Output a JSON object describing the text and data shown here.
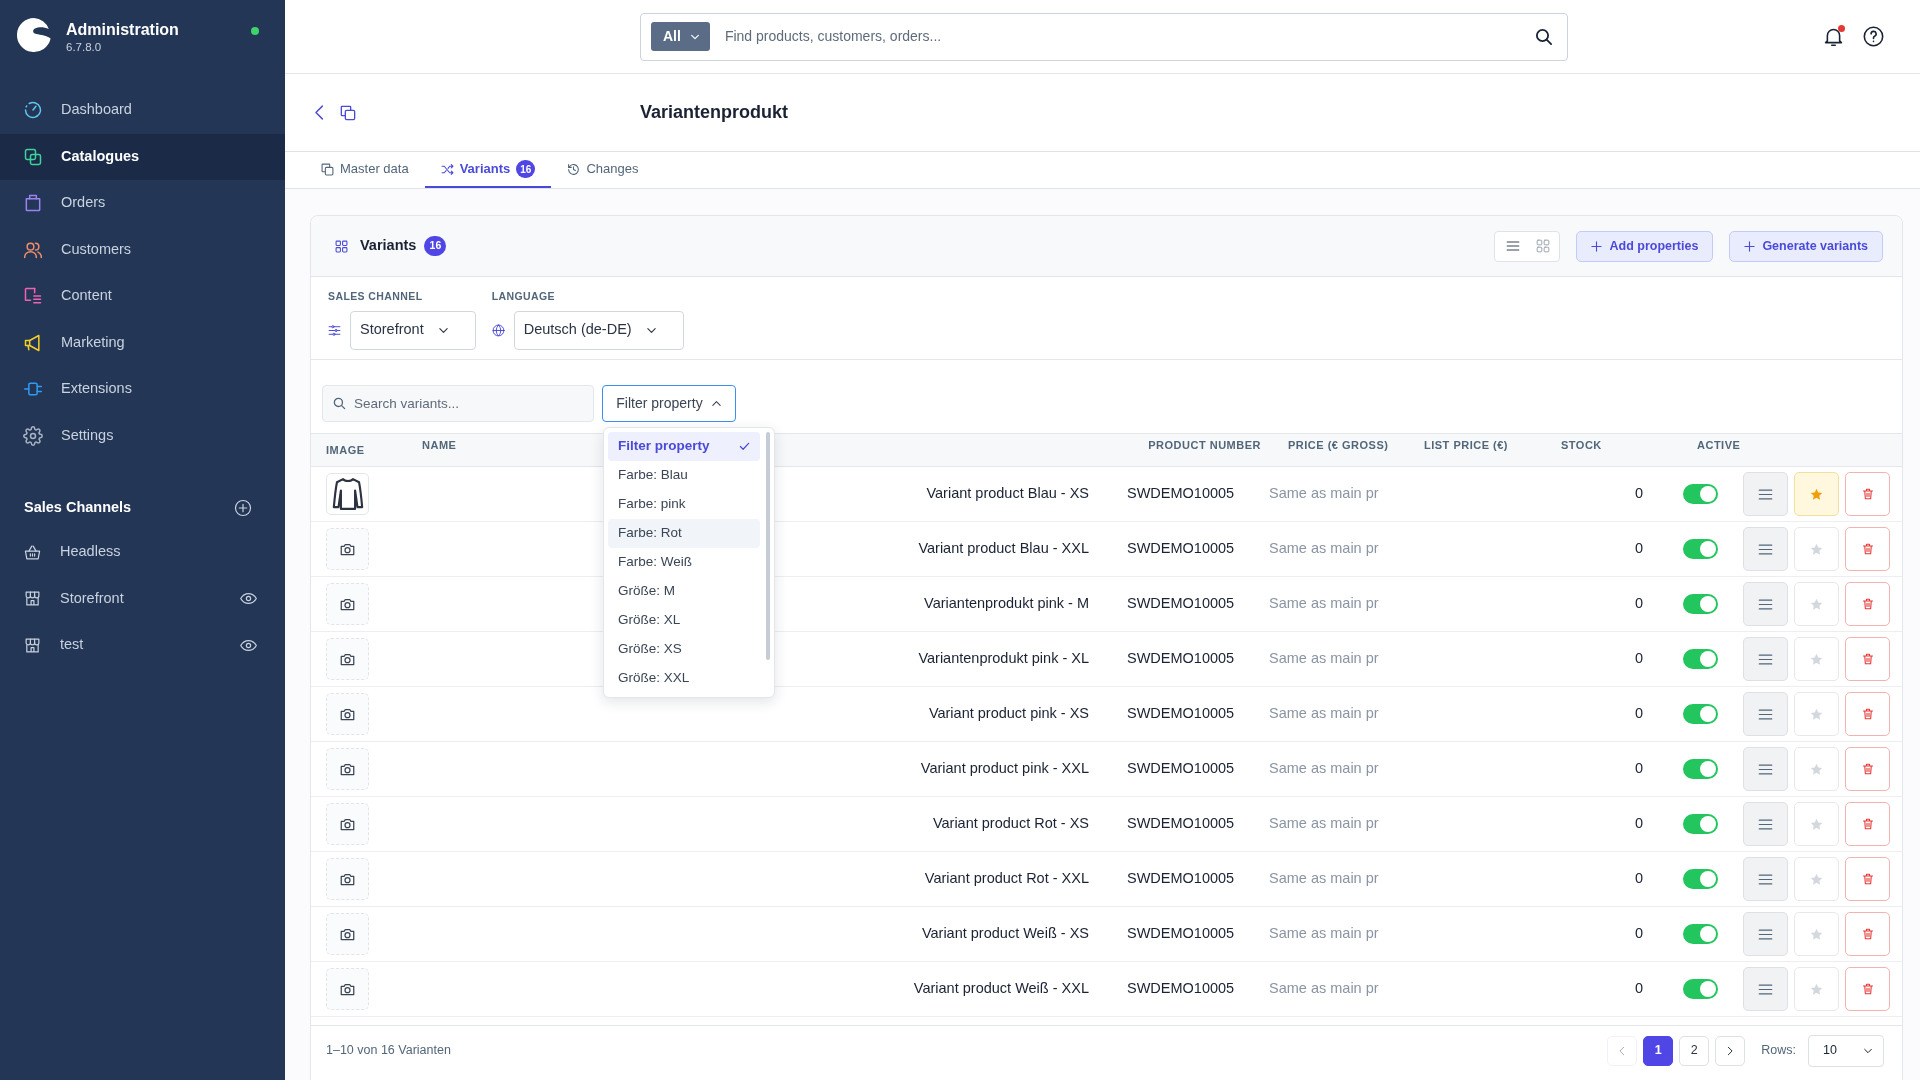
{
  "sidebar": {
    "app_title": "Administration",
    "version": "6.7.8.0",
    "online": true,
    "items": [
      {
        "label": "Dashboard",
        "selected": false
      },
      {
        "label": "Catalogues",
        "selected": true
      },
      {
        "label": "Orders",
        "selected": false
      },
      {
        "label": "Customers",
        "selected": false
      },
      {
        "label": "Content",
        "selected": false
      },
      {
        "label": "Marketing",
        "selected": false
      },
      {
        "label": "Extensions",
        "selected": false
      },
      {
        "label": "Settings",
        "selected": false
      }
    ],
    "sales_channels": {
      "title": "Sales Channels",
      "items": [
        {
          "label": "Headless",
          "kind": "headless"
        },
        {
          "label": "Storefront",
          "kind": "storefront"
        },
        {
          "label": "test",
          "kind": "storefront"
        }
      ]
    }
  },
  "topbar": {
    "scope": "All",
    "search": {
      "placeholder": "Find products, customers, orders..."
    },
    "unread_notifications": true
  },
  "page": {
    "title": "Variantenprodukt"
  },
  "tabs": [
    {
      "label": "Master data",
      "selected": false
    },
    {
      "label": "Variants",
      "badge": "16",
      "selected": true
    },
    {
      "label": "Changes",
      "selected": false
    }
  ],
  "variants": {
    "title": "Variants",
    "count": "16",
    "view_modes": [
      {
        "kind": "list",
        "selected": true
      },
      {
        "kind": "grid",
        "selected": false
      }
    ],
    "buttons": [
      "Add properties",
      "Generate variants"
    ],
    "filters": [
      {
        "kind": "sales_channel",
        "label": "SALES CHANNEL",
        "value": "Storefront"
      },
      {
        "kind": "language",
        "label": "LANGUAGE",
        "value": "Deutsch (de-DE)"
      }
    ],
    "search": {
      "placeholder": "Search variants..."
    },
    "filter_property": {
      "label": "Filter property",
      "expanded": true,
      "options": [
        {
          "label": "Filter property",
          "selected": true,
          "hovered": false
        },
        {
          "label": "Farbe: Blau",
          "selected": false,
          "hovered": false
        },
        {
          "label": "Farbe: pink",
          "selected": false,
          "hovered": false
        },
        {
          "label": "Farbe: Rot",
          "selected": false,
          "hovered": true
        },
        {
          "label": "Farbe: Weiß",
          "selected": false,
          "hovered": false
        },
        {
          "label": "Größe: M",
          "selected": false,
          "hovered": false
        },
        {
          "label": "Größe: XL",
          "selected": false,
          "hovered": false
        },
        {
          "label": "Größe: XS",
          "selected": false,
          "hovered": false
        },
        {
          "label": "Größe: XXL",
          "selected": false,
          "hovered": false
        }
      ]
    },
    "table": {
      "columns": [
        "IMAGE",
        "NAME",
        "PRODUCT NUMBER",
        "PRICE (€ GROSS)",
        "LIST PRICE (€)",
        "STOCK",
        "ACTIVE"
      ],
      "rows": [
        {
          "has_image": true,
          "name": "Variant product Blau - XS",
          "product_number": "SWDEMO10005",
          "price": "Same as main pr",
          "stock": "0",
          "active": true,
          "favorite": true
        },
        {
          "has_image": false,
          "name": "Variant product Blau - XXL",
          "product_number": "SWDEMO10005",
          "price": "Same as main pr",
          "stock": "0",
          "active": true,
          "favorite": false
        },
        {
          "has_image": false,
          "name": "Variantenprodukt pink - M",
          "product_number": "SWDEMO10005",
          "price": "Same as main pr",
          "stock": "0",
          "active": true,
          "favorite": false
        },
        {
          "has_image": false,
          "name": "Variantenprodukt pink - XL",
          "product_number": "SWDEMO10005",
          "price": "Same as main pr",
          "stock": "0",
          "active": true,
          "favorite": false
        },
        {
          "has_image": false,
          "name": "Variant product pink - XS",
          "product_number": "SWDEMO10005",
          "price": "Same as main pr",
          "stock": "0",
          "active": true,
          "favorite": false
        },
        {
          "has_image": false,
          "name": "Variant product pink - XXL",
          "product_number": "SWDEMO10005",
          "price": "Same as main pr",
          "stock": "0",
          "active": true,
          "favorite": false
        },
        {
          "has_image": false,
          "name": "Variant product Rot - XS",
          "product_number": "SWDEMO10005",
          "price": "Same as main pr",
          "stock": "0",
          "active": true,
          "favorite": false
        },
        {
          "has_image": false,
          "name": "Variant product Rot - XXL",
          "product_number": "SWDEMO10005",
          "price": "Same as main pr",
          "stock": "0",
          "active": true,
          "favorite": false
        },
        {
          "has_image": false,
          "name": "Variant product Weiß - XS",
          "product_number": "SWDEMO10005",
          "price": "Same as main pr",
          "stock": "0",
          "active": true,
          "favorite": false
        },
        {
          "has_image": false,
          "name": "Variant product Weiß - XXL",
          "product_number": "SWDEMO10005",
          "price": "Same as main pr",
          "stock": "0",
          "active": true,
          "favorite": false
        }
      ]
    },
    "pagination": {
      "summary": "1–10 von 16 Varianten",
      "previous_disabled": true,
      "pages": [
        {
          "label": "1",
          "selected": true
        },
        {
          "label": "2",
          "selected": false
        }
      ],
      "rows_label": "Rows:",
      "rows_value": "10"
    }
  }
}
